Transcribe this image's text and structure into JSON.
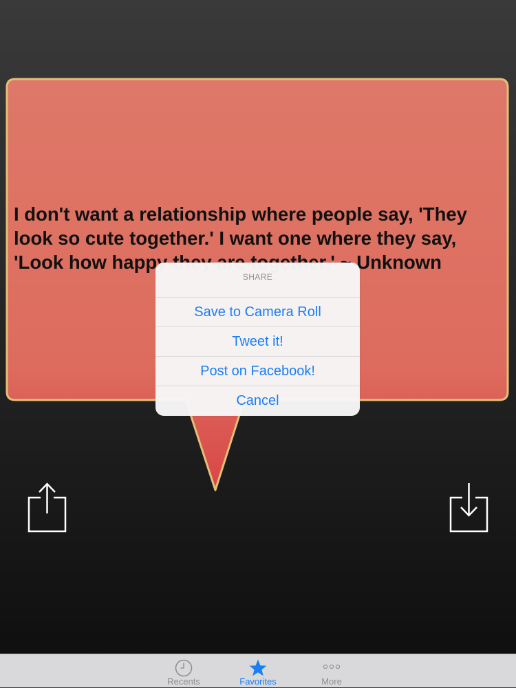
{
  "quote": {
    "text": "I don't want a relationship where people say, 'They\nlook so cute together.' I want one where they say,\n'Look how happy they are together.' ~ Unknown"
  },
  "share_sheet": {
    "title": "SHARE",
    "buttons": [
      {
        "label": "Save to Camera Roll"
      },
      {
        "label": "Tweet it!"
      },
      {
        "label": "Post on Facebook!"
      },
      {
        "label": "Cancel"
      }
    ]
  },
  "tabbar": {
    "tabs": [
      {
        "label": "Recents",
        "icon": "clock-icon",
        "active": false
      },
      {
        "label": "Favorites",
        "icon": "star-icon",
        "active": true
      },
      {
        "label": "More",
        "icon": "more-dots-icon",
        "active": false
      }
    ]
  },
  "colors": {
    "accent": "#1a7ef5",
    "bubble_fill_top": "#de7868",
    "bubble_fill_bottom": "#d94545",
    "bubble_border": "#e3c077"
  },
  "icons": {
    "share": "share-icon",
    "download": "download-icon"
  }
}
